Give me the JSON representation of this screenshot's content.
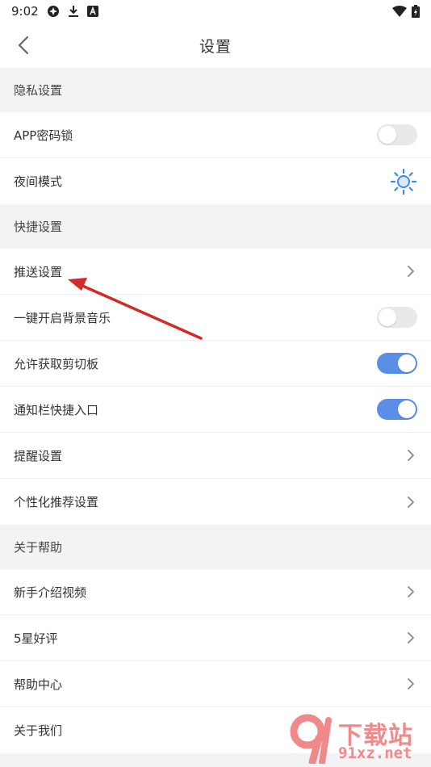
{
  "status_bar": {
    "time": "9:02"
  },
  "header": {
    "title": "设置"
  },
  "sections": [
    {
      "title": "隐私设置",
      "rows": [
        {
          "label": "APP密码锁",
          "control": "toggle",
          "on": false
        },
        {
          "label": "夜间模式",
          "control": "sun"
        }
      ]
    },
    {
      "title": "快捷设置",
      "rows": [
        {
          "label": "推送设置",
          "control": "chevron"
        },
        {
          "label": "一键开启背景音乐",
          "control": "toggle",
          "on": false
        },
        {
          "label": "允许获取剪切板",
          "control": "toggle",
          "on": true
        },
        {
          "label": "通知栏快捷入口",
          "control": "toggle",
          "on": true
        },
        {
          "label": "提醒设置",
          "control": "chevron"
        },
        {
          "label": "个性化推荐设置",
          "control": "chevron"
        }
      ]
    },
    {
      "title": "关于帮助",
      "rows": [
        {
          "label": "新手介绍视频",
          "control": "chevron"
        },
        {
          "label": "5星好评",
          "control": "chevron"
        },
        {
          "label": "帮助中心",
          "control": "chevron"
        },
        {
          "label": "关于我们",
          "control": "none"
        }
      ]
    }
  ],
  "colors": {
    "toggle_on": "#5b8ee6",
    "toggle_off": "#e9e9eb",
    "annotation_arrow": "#d42a2a",
    "sun_icon": "#3d8be0"
  },
  "watermark": {
    "top_text": "下载站",
    "bottom_text": "91xz.net"
  }
}
